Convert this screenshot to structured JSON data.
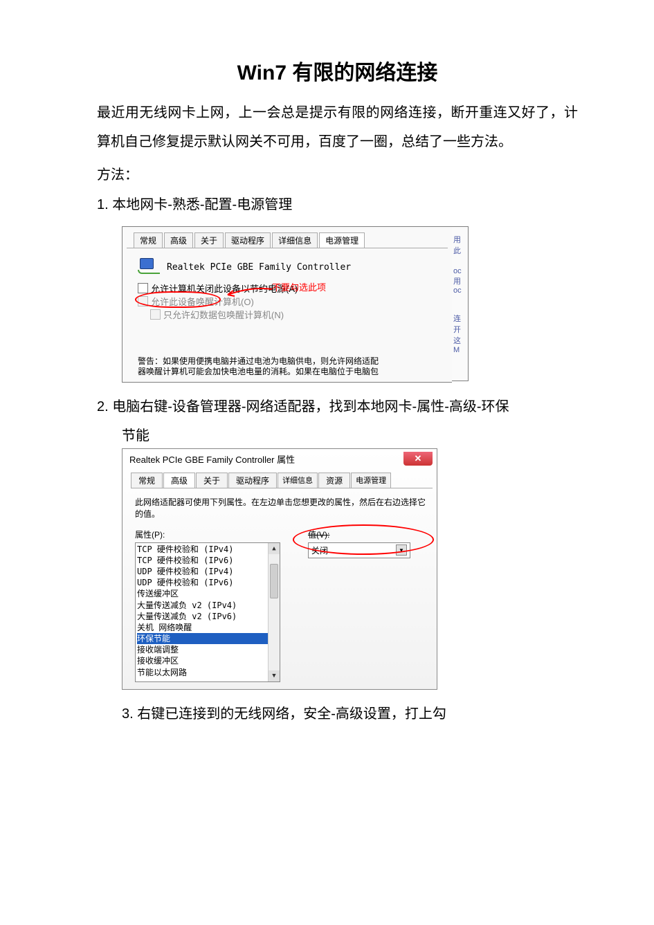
{
  "title": "Win7 有限的网络连接",
  "intro": "最近用无线网卡上网，上一会总是提示有限的网络连接，断开重连又好了，计算机自己修复提示默认网关不可用，百度了一圈，总结了一些方法。",
  "method_label": "方法：",
  "steps": {
    "s1": "1. 本地网卡-熟悉-配置-电源管理",
    "s2a": "2. 电脑右键-设备管理器-网络适配器，找到本地网卡-属性-高级-环保",
    "s2b": "节能",
    "s3": "3. 右键已连接到的无线网络，安全-高级设置，打上勾"
  },
  "shot1": {
    "tabs": [
      "常规",
      "高级",
      "关于",
      "驱动程序",
      "详细信息",
      "电源管理"
    ],
    "active_tab_index": 5,
    "device_name": "Realtek PCIe GBE Family Controller",
    "red_note": "不要勾选此项",
    "cb1": "允许计算机关闭此设备以节约电源(A)",
    "cb2": "允许此设备唤醒计算机(O)",
    "cb3": "只允许幻数据包唤醒计算机(N)",
    "warn_line1": "警告：如果使用便携电脑并通过电池为电脑供电，则允许网络适配",
    "warn_line2": "器唤醒计算机可能会加快电池电量的消耗。如果在电脑位于电脑包",
    "side": [
      "用此",
      "oc",
      "用",
      "oc",
      "连",
      "开这",
      "M"
    ]
  },
  "shot2": {
    "title": "Realtek PCIe GBE Family Controller 属性",
    "tabs": [
      "常规",
      "高级",
      "关于",
      "驱动程序",
      "详细信息",
      "资源",
      "电源管理"
    ],
    "active_tab_index": 1,
    "hint": "此网络适配器可使用下列属性。在左边单击您想更改的属性，然后在右边选择它的值。",
    "props_label": "属性(P):",
    "value_label": "值(V):",
    "value_selected": "关闭",
    "props": [
      "TCP 硬件校验和 (IPv4)",
      "TCP 硬件校验和 (IPv6)",
      "UDP 硬件校验和 (IPv4)",
      "UDP 硬件校验和 (IPv6)",
      "传送缓冲区",
      "大量传送减负 v2 (IPv4)",
      "大量传送减负 v2 (IPv6)",
      "关机 网络唤醒",
      "环保节能",
      "接收端调整",
      "接收缓冲区",
      "节能以太网路"
    ],
    "selected_index": 8
  }
}
